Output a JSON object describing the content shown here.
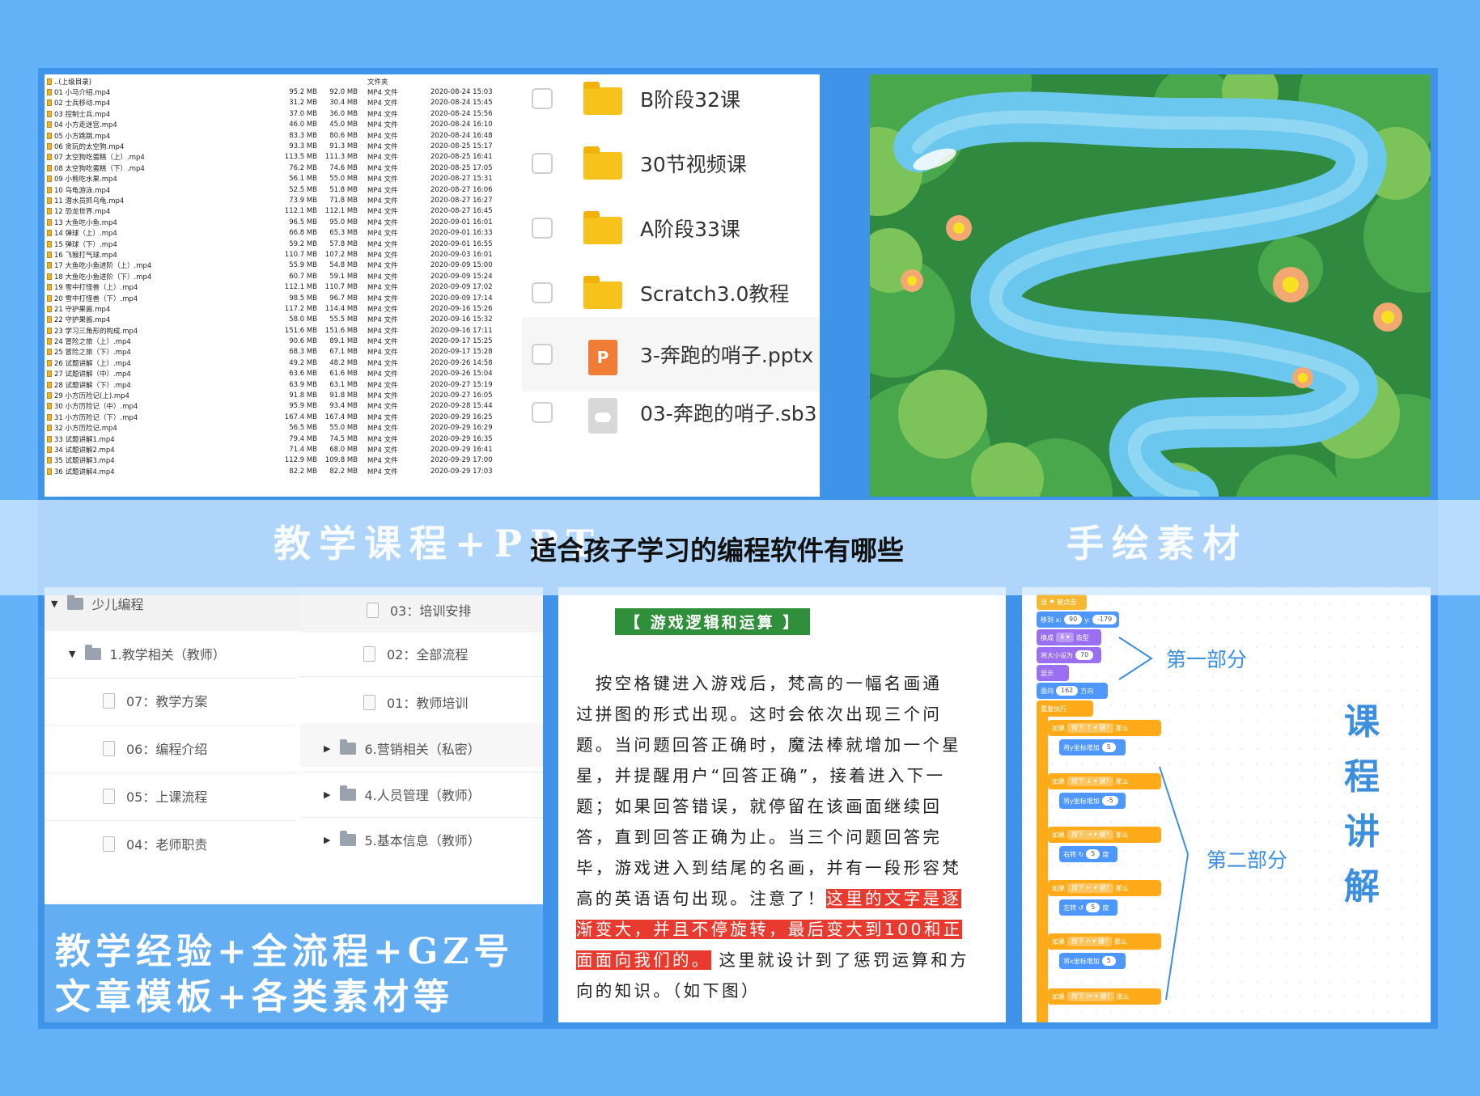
{
  "headline": "适合孩子学习的编程软件有哪些",
  "band": {
    "left_caption": "教学课程+PPT",
    "right_caption": "手绘素材"
  },
  "files": {
    "rows": [
      {
        "name": "..(上级目录)",
        "size": "",
        "size2": "",
        "type": "文件夹",
        "date": ""
      },
      {
        "name": "01 小马介绍.mp4",
        "size": "95.2 MB",
        "size2": "92.0 MB",
        "type": "MP4 文件",
        "date": "2020-08-24 15:03"
      },
      {
        "name": "02 士兵移动.mp4",
        "size": "31.2 MB",
        "size2": "30.4 MB",
        "type": "MP4 文件",
        "date": "2020-08-24 15:45"
      },
      {
        "name": "03 控制士兵.mp4",
        "size": "37.0 MB",
        "size2": "36.0 MB",
        "type": "MP4 文件",
        "date": "2020-08-24 15:56"
      },
      {
        "name": "04 小方走迷宫.mp4",
        "size": "46.0 MB",
        "size2": "45.0 MB",
        "type": "MP4 文件",
        "date": "2020-08-24 16:10"
      },
      {
        "name": "05 小方跳跳.mp4",
        "size": "83.3 MB",
        "size2": "80.6 MB",
        "type": "MP4 文件",
        "date": "2020-08-24 16:48"
      },
      {
        "name": "06 贪玩的太空狗.mp4",
        "size": "93.3 MB",
        "size2": "91.3 MB",
        "type": "MP4 文件",
        "date": "2020-08-25 15:17"
      },
      {
        "name": "07 太空狗吃蛋糕（上）.mp4",
        "size": "113.5 MB",
        "size2": "111.3 MB",
        "type": "MP4 文件",
        "date": "2020-08-25 16:41"
      },
      {
        "name": "08 太空狗吃蛋糕（下）.mp4",
        "size": "76.2 MB",
        "size2": "74.6 MB",
        "type": "MP4 文件",
        "date": "2020-08-25 17:05"
      },
      {
        "name": "09 小熊吃水果.mp4",
        "size": "56.1 MB",
        "size2": "55.0 MB",
        "type": "MP4 文件",
        "date": "2020-08-27 15:31"
      },
      {
        "name": "10 乌龟游泳.mp4",
        "size": "52.5 MB",
        "size2": "51.8 MB",
        "type": "MP4 文件",
        "date": "2020-08-27 16:06"
      },
      {
        "name": "11 潜水员抓乌龟.mp4",
        "size": "73.9 MB",
        "size2": "71.8 MB",
        "type": "MP4 文件",
        "date": "2020-08-27 16:27"
      },
      {
        "name": "12 恐龙世界.mp4",
        "size": "112.1 MB",
        "size2": "112.1 MB",
        "type": "MP4 文件",
        "date": "2020-08-27 16:45"
      },
      {
        "name": "13 大鱼吃小鱼.mp4",
        "size": "96.5 MB",
        "size2": "95.0 MB",
        "type": "MP4 文件",
        "date": "2020-09-01 16:01"
      },
      {
        "name": "14 弹球（上）.mp4",
        "size": "66.8 MB",
        "size2": "65.3 MB",
        "type": "MP4 文件",
        "date": "2020-09-01 16:33"
      },
      {
        "name": "15 弹球（下）.mp4",
        "size": "59.2 MB",
        "size2": "57.8 MB",
        "type": "MP4 文件",
        "date": "2020-09-01 16:55"
      },
      {
        "name": "16 飞猴打气球.mp4",
        "size": "110.7 MB",
        "size2": "107.2 MB",
        "type": "MP4 文件",
        "date": "2020-09-03 16:01"
      },
      {
        "name": "17 大鱼吃小鱼进阶（上）.mp4",
        "size": "55.9 MB",
        "size2": "54.8 MB",
        "type": "MP4 文件",
        "date": "2020-09-09 15:00"
      },
      {
        "name": "18 大鱼吃小鱼进阶（下）.mp4",
        "size": "60.7 MB",
        "size2": "59.1 MB",
        "type": "MP4 文件",
        "date": "2020-09-09 15:24"
      },
      {
        "name": "19 雪中打怪兽（上）.mp4",
        "size": "112.1 MB",
        "size2": "110.7 MB",
        "type": "MP4 文件",
        "date": "2020-09-09 17:02"
      },
      {
        "name": "20 雪中打怪兽（下）.mp4",
        "size": "98.5 MB",
        "size2": "96.7 MB",
        "type": "MP4 文件",
        "date": "2020-09-09 17:14"
      },
      {
        "name": "21 守护果酱.mp4",
        "size": "117.2 MB",
        "size2": "114.4 MB",
        "type": "MP4 文件",
        "date": "2020-09-16 15:26"
      },
      {
        "name": "22 守护果酱.mp4",
        "size": "58.0 MB",
        "size2": "55.5 MB",
        "type": "MP4 文件",
        "date": "2020-09-16 15:32"
      },
      {
        "name": "23 学习三角形的构成.mp4",
        "size": "151.6 MB",
        "size2": "151.6 MB",
        "type": "MP4 文件",
        "date": "2020-09-16 17:11"
      },
      {
        "name": "24 冒险之旅（上）.mp4",
        "size": "90.6 MB",
        "size2": "89.1 MB",
        "type": "MP4 文件",
        "date": "2020-09-17 15:25"
      },
      {
        "name": "25 冒险之旅（下）.mp4",
        "size": "68.3 MB",
        "size2": "67.1 MB",
        "type": "MP4 文件",
        "date": "2020-09-17 15:28"
      },
      {
        "name": "26 试题讲解（上）.mp4",
        "size": "49.2 MB",
        "size2": "48.2 MB",
        "type": "MP4 文件",
        "date": "2020-09-26 14:58"
      },
      {
        "name": "27 试题讲解（中）.mp4",
        "size": "63.6 MB",
        "size2": "61.6 MB",
        "type": "MP4 文件",
        "date": "2020-09-26 15:04"
      },
      {
        "name": "28 试题讲解（下）.mp4",
        "size": "63.9 MB",
        "size2": "63.1 MB",
        "type": "MP4 文件",
        "date": "2020-09-27 15:19"
      },
      {
        "name": "29 小方历险记(上).mp4",
        "size": "91.8 MB",
        "size2": "91.8 MB",
        "type": "MP4 文件",
        "date": "2020-09-27 16:05"
      },
      {
        "name": "30 小方历险记（中）.mp4",
        "size": "95.9 MB",
        "size2": "93.4 MB",
        "type": "MP4 文件",
        "date": "2020-09-28 15:44"
      },
      {
        "name": "31 小方历险记（下）.mp4",
        "size": "167.4 MB",
        "size2": "167.4 MB",
        "type": "MP4 文件",
        "date": "2020-09-29 16:25"
      },
      {
        "name": "32 小方历险记.mp4",
        "size": "56.5 MB",
        "size2": "55.0 MB",
        "type": "MP4 文件",
        "date": "2020-09-29 16:29"
      },
      {
        "name": "33 试题讲解1.mp4",
        "size": "79.4 MB",
        "size2": "74.5 MB",
        "type": "MP4 文件",
        "date": "2020-09-29 16:35"
      },
      {
        "name": "34 试题讲解2.mp4",
        "size": "71.4 MB",
        "size2": "68.0 MB",
        "type": "MP4 文件",
        "date": "2020-09-29 16:41"
      },
      {
        "name": "35 试题讲解3.mp4",
        "size": "112.9 MB",
        "size2": "109.8 MB",
        "type": "MP4 文件",
        "date": "2020-09-29 17:00"
      },
      {
        "name": "36 试题讲解4.mp4",
        "size": "82.2 MB",
        "size2": "82.2 MB",
        "type": "MP4 文件",
        "date": "2020-09-29 17:03"
      }
    ],
    "folders": [
      {
        "label": "B阶段32课",
        "kind": "folder"
      },
      {
        "label": "30节视频课",
        "kind": "folder"
      },
      {
        "label": "A阶段33课",
        "kind": "folder"
      },
      {
        "label": "Scratch3.0教程",
        "kind": "folder"
      },
      {
        "label": "3-奔跑的哨子.pptx",
        "kind": "pptx",
        "icon_text": "P"
      },
      {
        "label": "03-奔跑的哨子.sb3",
        "kind": "sb3"
      }
    ]
  },
  "tree": {
    "root": "少儿编程",
    "left": {
      "folder": "1.教学相关（教师）",
      "docs": [
        "07：教学方案",
        "06：编程介绍",
        "05：上课流程",
        "04：老师职责"
      ]
    },
    "right": {
      "docs": [
        "03：培训安排",
        "02：全部流程",
        "01：教师培训"
      ],
      "folders": [
        "6.营销相关（私密）",
        "4.人员管理（教师）",
        "5.基本信息（教师）"
      ]
    },
    "caption_line1": "教学经验+全流程+GZ号",
    "caption_line2": "文章模板+各类素材等"
  },
  "doc": {
    "tag": "【 游戏逻辑和运算 】",
    "lines": [
      "　按空格键进入游戏后，梵高的一幅名画通",
      "过拼图的形式出现。这时会依次出现三个问",
      "题。当问题回答正确时，魔法棒就增加一个星",
      "星，并提醒用户“回答正确”，接着进入下一",
      "题；如果回答错误，就停留在该画面继续回",
      "答，直到回答正确为止。当三个问题回答完",
      "毕，游戏进入到结尾的名画，并有一段形容梵"
    ],
    "line8_a": "高的英语语句出现。注意了！",
    "line8_red": "这里的文字是逐",
    "line9_red": "渐变大，并且不停旋转，最后变大到100和正",
    "line10_red": "面面向我们的。",
    "line10_b": "这里就设计到了惩罚运算和方",
    "line11": "向的知识。（如下图）"
  },
  "scratch": {
    "part1": "第一部分",
    "part2": "第二部分",
    "title_chars": [
      "课",
      "程",
      "讲",
      "解"
    ],
    "blocks": {
      "when_clicked": "当 ⚑ 被点击",
      "goto": "移到 x:",
      "goto_x": "90",
      "goto_y_label": "y:",
      "goto_y": "-179",
      "switch": "换成",
      "switch_val": "4 ▾",
      "switch_suffix": "造型",
      "size": "将大小设为",
      "size_val": "70",
      "show": "显示",
      "dir": "面向",
      "dir_val": "162",
      "dir_suffix": "方向",
      "forever": "重复执行",
      "if": "如果",
      "press": "按下",
      "key_q": "键?",
      "then": "那么",
      "k1": "↑ ▾",
      "k2": "↓ ▾",
      "k3": "→ ▾",
      "k4": "← ▾",
      "k5": "n ▾",
      "k6": "m ▾",
      "change_y": "将y坐标增加",
      "v5": "5",
      "vm5": "-5",
      "turn_r": "右转 ↻",
      "turn_l": "左转 ↺",
      "deg": "度",
      "change_x": "将x坐标增加"
    }
  },
  "colors": {
    "background": "#63b1f7",
    "frame": "#3f93e8",
    "river": "#6cc7ee",
    "leaf_dark": "#2e8a3e",
    "leaf_light": "#7cc35a",
    "accent_blue": "#3d8fde",
    "highlight_red": "#e83a2e"
  }
}
